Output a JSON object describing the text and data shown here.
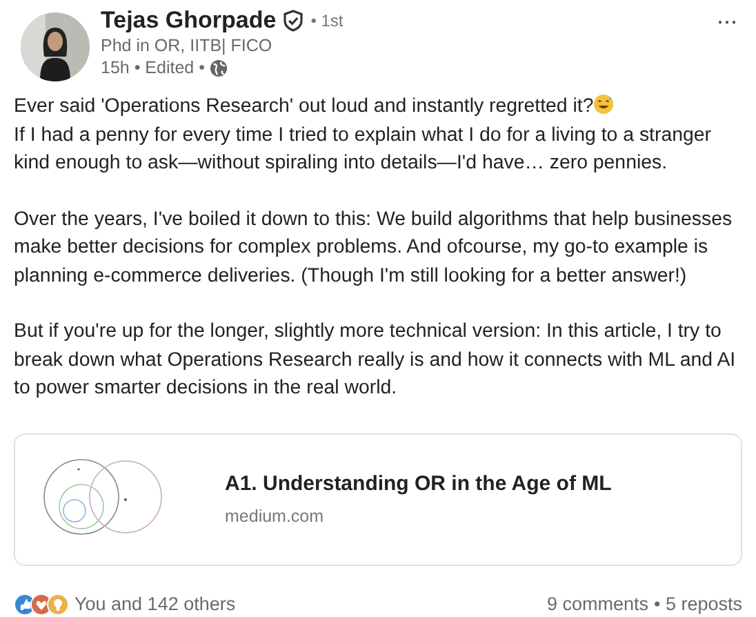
{
  "author": {
    "name": "Tejas Ghorpade",
    "verified": true,
    "degree": "• 1st",
    "headline": "Phd in OR, IITB| FICO",
    "time": "15h • Edited •"
  },
  "menu": "···",
  "paragraphs": [
    {
      "lines": [
        "Ever said 'Operations Research' out loud and instantly regretted it?",
        " If I had a penny for every time I tried to explain what I do for a living to a stranger",
        "kind enough to ask—without spiraling into details—I'd have… zero pennies."
      ],
      "emoji": true
    },
    {
      "lines": [
        "Over the years, I've boiled it down to this: We build algorithms that help businesses",
        "make better decisions for complex problems. And ofcourse, my go-to example is",
        "planning e-commerce deliveries. (Though I'm still looking for a better answer!)"
      ],
      "emoji": false
    },
    {
      "lines": [
        "But if you're up for the longer, slightly more technical version: In this article, I try to",
        "break down what Operations Research really is and how it connects with ML and AI",
        "to power smarter decisions in the real world."
      ],
      "emoji": false
    }
  ],
  "link_card": {
    "title": "A1. Understanding OR in the Age of ML",
    "domain": "medium.com"
  },
  "reactions": {
    "summary": "You and 142 others",
    "comments": "9 comments",
    "reposts": "• 5 reposts"
  }
}
